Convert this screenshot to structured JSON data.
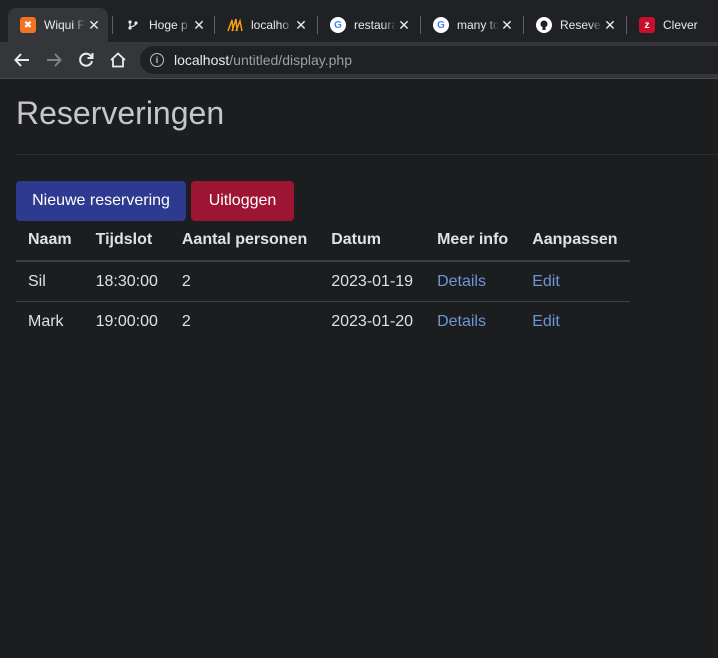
{
  "browser": {
    "tabs": [
      {
        "title": "Wiqui F",
        "icon": "xampp-icon",
        "active": true
      },
      {
        "title": "Hoge p",
        "icon": "git-branch-icon",
        "active": false
      },
      {
        "title": "localho",
        "icon": "phpmyadmin-icon",
        "active": false
      },
      {
        "title": "restaura",
        "icon": "google-icon",
        "active": false
      },
      {
        "title": "many to",
        "icon": "google-icon",
        "active": false
      },
      {
        "title": "Resever",
        "icon": "github-icon",
        "active": false
      },
      {
        "title": "Clever",
        "icon": "clever-icon",
        "active": false
      }
    ],
    "url_host": "localhost",
    "url_path": "/untitled/display.php"
  },
  "page": {
    "title": "Reserveringen",
    "new_button": "Nieuwe reservering",
    "logout_button": "Uitloggen"
  },
  "table": {
    "headers": [
      "Naam",
      "Tijdslot",
      "Aantal personen",
      "Datum",
      "Meer info",
      "Aanpassen"
    ],
    "rows": [
      {
        "naam": "Sil",
        "tijdslot": "18:30:00",
        "personen": "2",
        "datum": "2023-01-19",
        "info": "Details",
        "edit": "Edit"
      },
      {
        "naam": "Mark",
        "tijdslot": "19:00:00",
        "personen": "2",
        "datum": "2023-01-20",
        "info": "Details",
        "edit": "Edit"
      }
    ]
  },
  "colors": {
    "background": "#1c1d1f",
    "primary_button": "#2e3a8f",
    "danger_button": "#9c1634",
    "link": "#6d97d9"
  }
}
